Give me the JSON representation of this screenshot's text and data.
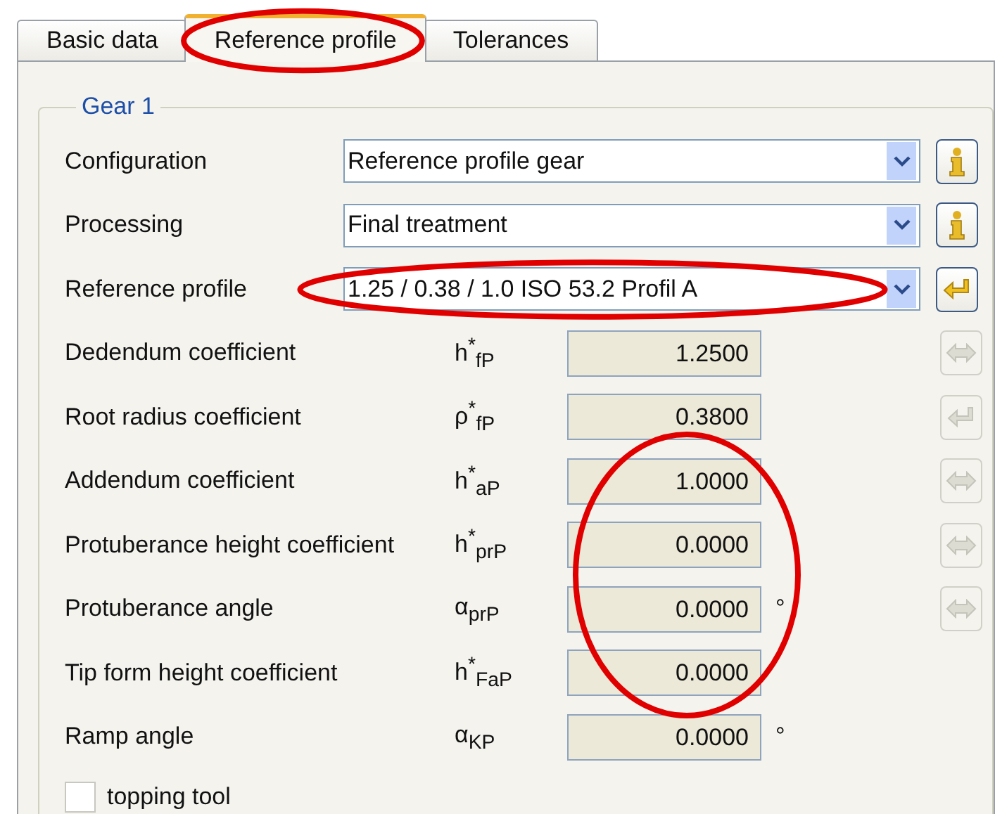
{
  "tabs": [
    {
      "label": "Basic data",
      "selected": false,
      "circled": false
    },
    {
      "label": "Reference profile",
      "selected": true,
      "circled": true
    },
    {
      "label": "Tolerances",
      "selected": false,
      "circled": false
    }
  ],
  "group": {
    "title": "Gear 1",
    "selects": [
      {
        "label": "Configuration",
        "value": "Reference profile gear",
        "circled": false,
        "button": {
          "kind": "info",
          "disabled": false
        }
      },
      {
        "label": "Processing",
        "value": "Final treatment",
        "circled": false,
        "button": {
          "kind": "info",
          "disabled": false
        }
      },
      {
        "label": "Reference profile",
        "value": "1.25 / 0.38 / 1.0 ISO 53.2 Profil A",
        "circled": true,
        "button": {
          "kind": "return",
          "disabled": false
        }
      }
    ],
    "parameters": [
      {
        "label": "Dedendum coefficient",
        "symbol": "h$^{*}$$_{fP}$",
        "value": "1.2500",
        "button": {
          "kind": "swap",
          "disabled": true
        }
      },
      {
        "label": "Root radius coefficient",
        "symbol": "ρ$^{*}$$_{fP}$",
        "value": "0.3800",
        "button": {
          "kind": "return",
          "disabled": true
        }
      },
      {
        "label": "Addendum coefficient",
        "symbol": "h$^{*}$$_{aP}$",
        "value": "1.0000",
        "button": {
          "kind": "swap",
          "disabled": true
        }
      },
      {
        "label": "Protuberance height coefficient",
        "symbol": "h$^{*}$$_{prP}$",
        "value": "0.0000",
        "button": {
          "kind": "swap",
          "disabled": true
        }
      },
      {
        "label": "Protuberance angle",
        "symbol": "α$_{prP}$",
        "value": "0.0000",
        "unit": "°",
        "button": {
          "kind": "swap",
          "disabled": true
        }
      },
      {
        "label": "Tip form height coefficient",
        "symbol": "h$^{*}$$_{FaP}$",
        "value": "0.0000"
      },
      {
        "label": "Ramp angle",
        "symbol": "α$_{KP}$",
        "value": "0.0000",
        "unit": "°"
      }
    ],
    "values_circled": true,
    "checkbox": {
      "label": "topping tool",
      "checked": false
    }
  }
}
